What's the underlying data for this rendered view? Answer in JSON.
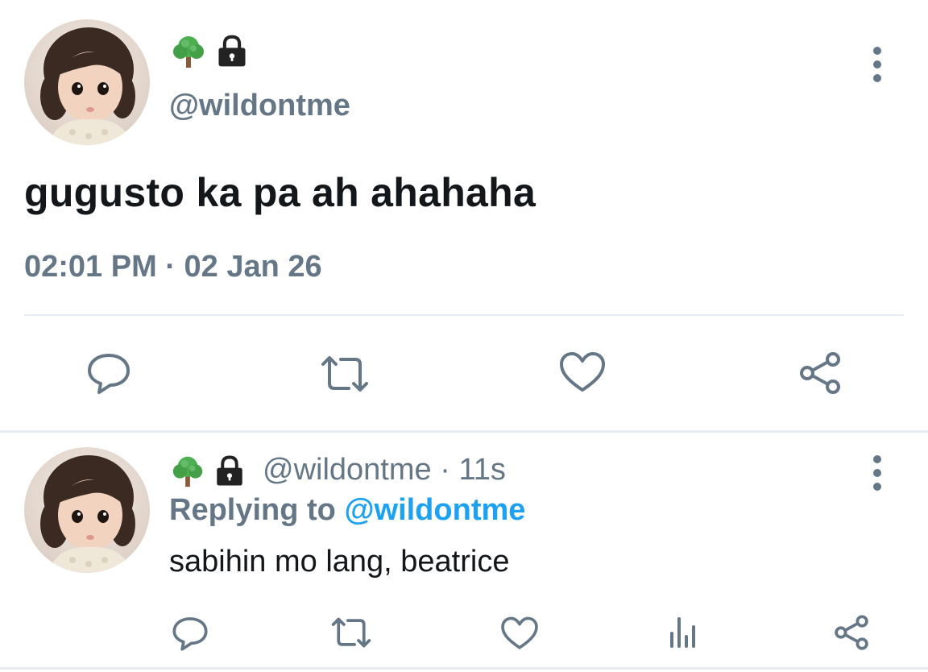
{
  "main_tweet": {
    "emojis": [
      "tree-icon",
      "lock-icon"
    ],
    "handle": "@wildontme",
    "text": "gugusto ka pa ah ahahaha",
    "timestamp": "02:01 PM · 02 Jan 26",
    "actions": [
      "reply-icon",
      "retweet-icon",
      "like-icon",
      "share-icon"
    ]
  },
  "reply_tweet": {
    "emojis": [
      "tree-icon",
      "lock-icon"
    ],
    "handle": "@wildontme",
    "separator": "·",
    "age": "11s",
    "replying_label": "Replying to",
    "replying_to": "@wildontme",
    "text": "sabihin mo lang, beatrice",
    "actions": [
      "reply-icon",
      "retweet-icon",
      "like-icon",
      "analytics-icon",
      "share-icon"
    ]
  },
  "colors": {
    "muted": "#657786",
    "link": "#1da1f2",
    "text": "#14171a",
    "divider": "#e6ecf0"
  }
}
